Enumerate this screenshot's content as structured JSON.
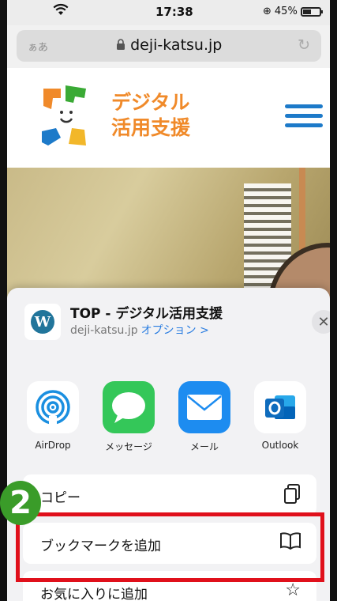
{
  "status_bar": {
    "time": "17:38",
    "battery_text": "45%",
    "battery_level": 0.45
  },
  "address_bar": {
    "aa_label": "ぁあ",
    "url": "deji-katsu.jp"
  },
  "site": {
    "logo_line1": "デジタル",
    "logo_line2": "活用支援"
  },
  "share_sheet": {
    "title": "TOP - デジタル活用支援",
    "subtitle": "deji-katsu.jp",
    "options_link": "オプション >",
    "close_symbol": "✕",
    "apps": [
      {
        "label": "AirDrop",
        "icon": "airdrop-icon"
      },
      {
        "label": "メッセージ",
        "icon": "messages-icon"
      },
      {
        "label": "メール",
        "icon": "mail-icon"
      },
      {
        "label": "Outlook",
        "icon": "outlook-icon"
      }
    ],
    "actions": [
      {
        "label": "コピー",
        "icon": "copy-icon"
      },
      {
        "label": "ブックマークを追加",
        "icon": "book-icon"
      },
      {
        "label": "お気に入りに追加",
        "icon": "star-icon"
      }
    ]
  },
  "annotation": {
    "step_number": "2",
    "highlight_color": "#e0101b",
    "badge_color": "#3a9c29"
  }
}
